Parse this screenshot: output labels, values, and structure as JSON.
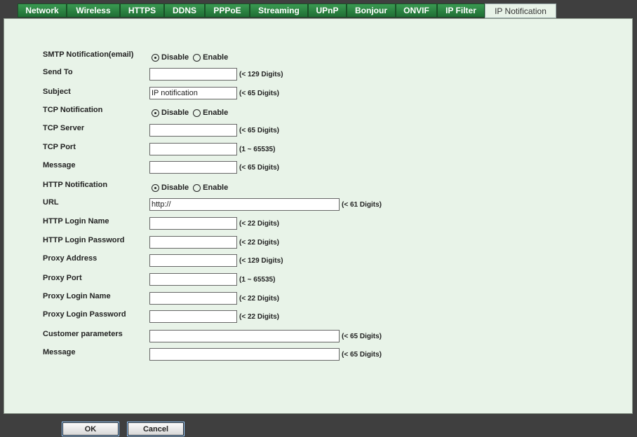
{
  "tabs": [
    {
      "label": "Network"
    },
    {
      "label": "Wireless"
    },
    {
      "label": "HTTPS"
    },
    {
      "label": "DDNS"
    },
    {
      "label": "PPPoE"
    },
    {
      "label": "Streaming"
    },
    {
      "label": "UPnP"
    },
    {
      "label": "Bonjour"
    },
    {
      "label": "ONVIF"
    },
    {
      "label": "IP Filter"
    },
    {
      "label": "IP Notification"
    }
  ],
  "active_tab": "IP Notification",
  "radio_labels": {
    "disable": "Disable",
    "enable": "Enable"
  },
  "form": {
    "smtp": {
      "label": "SMTP Notification(email)",
      "selected": "Disable"
    },
    "send_to": {
      "label": "Send To",
      "value": "",
      "hint": "(< 129 Digits)"
    },
    "subject": {
      "label": "Subject",
      "value": "IP notification",
      "hint": "(< 65 Digits)"
    },
    "tcp": {
      "label": "TCP Notification",
      "selected": "Disable"
    },
    "tcp_server": {
      "label": "TCP Server",
      "value": "",
      "hint": "(< 65 Digits)"
    },
    "tcp_port": {
      "label": "TCP Port",
      "value": "",
      "hint": "(1 ~ 65535)"
    },
    "tcp_message": {
      "label": "Message",
      "value": "",
      "hint": "(< 65 Digits)"
    },
    "http": {
      "label": "HTTP Notification",
      "selected": "Disable"
    },
    "url": {
      "label": "URL",
      "value": "http://",
      "hint": "(< 61 Digits)"
    },
    "http_login_name": {
      "label": "HTTP Login Name",
      "value": "",
      "hint": "(< 22 Digits)"
    },
    "http_login_password": {
      "label": "HTTP Login Password",
      "value": "",
      "hint": "(< 22 Digits)"
    },
    "proxy_address": {
      "label": "Proxy Address",
      "value": "",
      "hint": "(< 129 Digits)"
    },
    "proxy_port": {
      "label": "Proxy Port",
      "value": "",
      "hint": "(1 ~ 65535)"
    },
    "proxy_login_name": {
      "label": "Proxy Login Name",
      "value": "",
      "hint": "(< 22 Digits)"
    },
    "proxy_login_password": {
      "label": "Proxy Login Password",
      "value": "",
      "hint": "(< 22 Digits)"
    },
    "customer_parameters": {
      "label": "Customer parameters",
      "value": "",
      "hint": "(< 65 Digits)"
    },
    "http_message": {
      "label": "Message",
      "value": "",
      "hint": "(< 65 Digits)"
    }
  },
  "buttons": {
    "ok": "OK",
    "cancel": "Cancel"
  }
}
